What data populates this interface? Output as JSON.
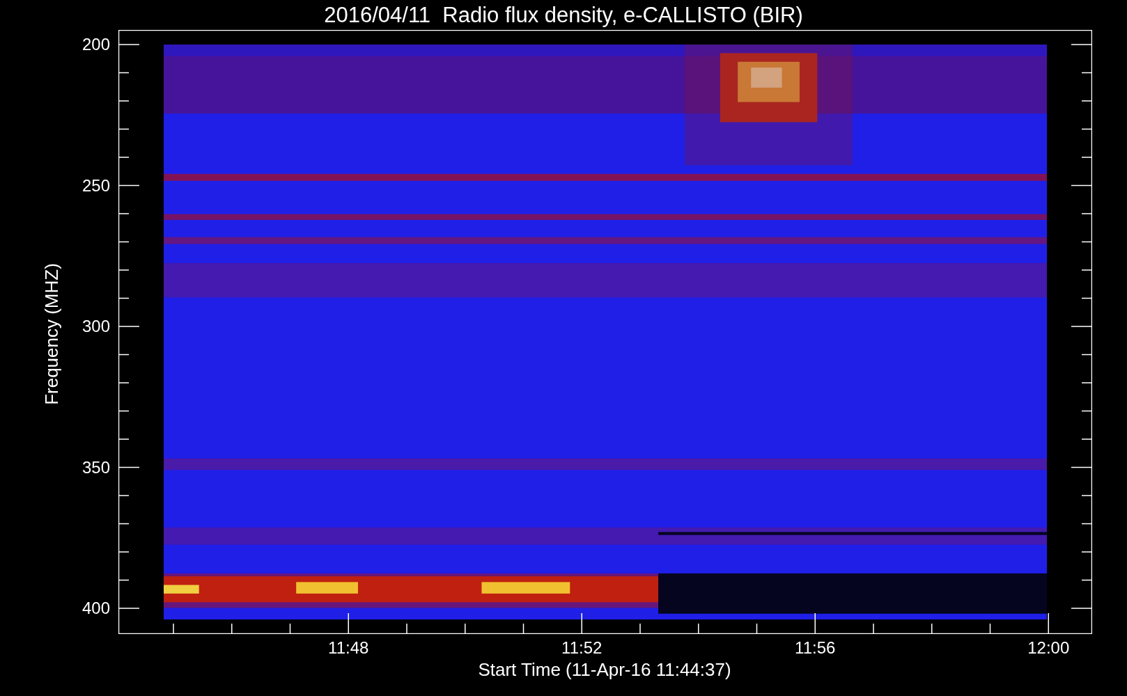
{
  "title": "2016/04/11  Radio flux density, e-CALLISTO (BIR)",
  "y_axis": {
    "label": "Frequency (MHZ)",
    "ticks": [
      "200",
      "250",
      "300",
      "350",
      "400"
    ]
  },
  "x_axis": {
    "label": "Start Time (11-Apr-16 11:44:37)",
    "ticks": [
      "11:48",
      "11:52",
      "11:56",
      "12:00"
    ]
  }
}
